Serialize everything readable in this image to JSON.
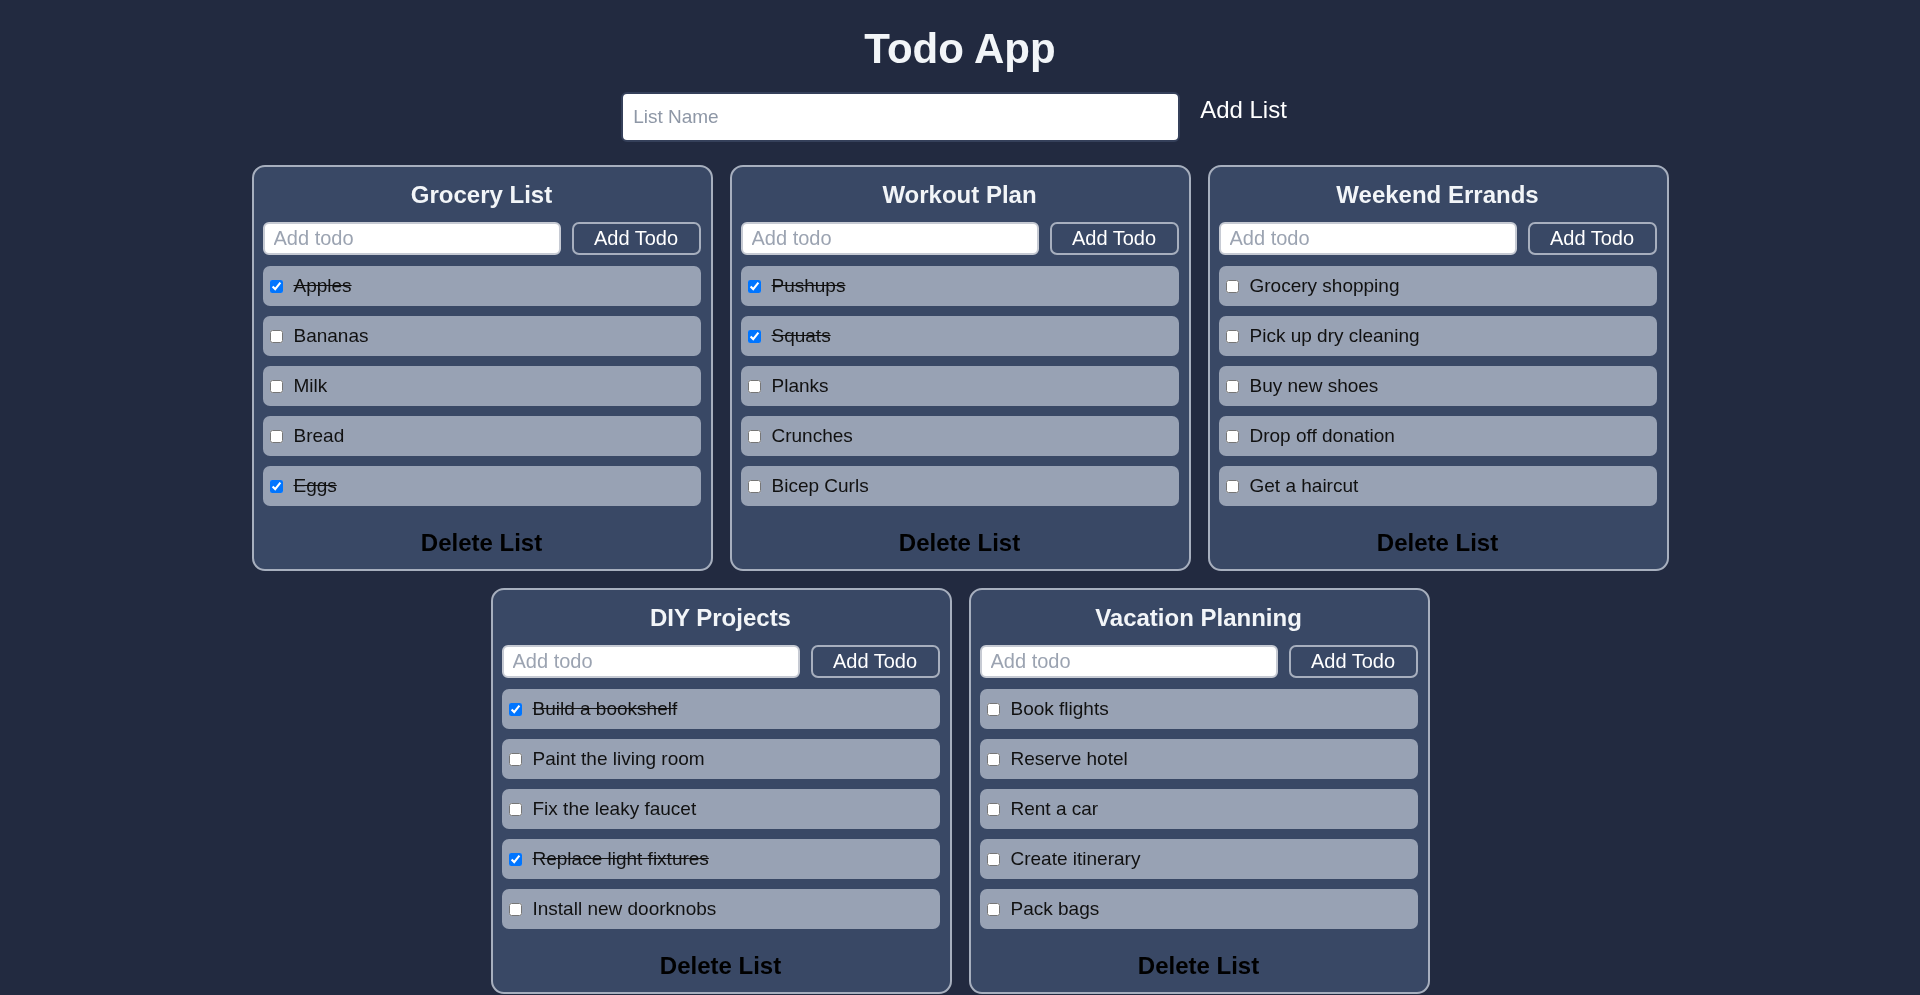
{
  "title": "Todo App",
  "new_list": {
    "placeholder": "List Name",
    "button": "Add List"
  },
  "lists": [
    {
      "name": "Grocery List",
      "todo_placeholder": "Add todo",
      "add_button": "Add Todo",
      "todos": [
        {
          "text": "Apples",
          "checked": true
        },
        {
          "text": "Bananas",
          "checked": false
        },
        {
          "text": "Milk",
          "checked": false
        },
        {
          "text": "Bread",
          "checked": false
        },
        {
          "text": "Eggs",
          "checked": true
        }
      ],
      "delete_button": "Delete List"
    },
    {
      "name": "Workout Plan",
      "todo_placeholder": "Add todo",
      "add_button": "Add Todo",
      "todos": [
        {
          "text": "Pushups",
          "checked": true
        },
        {
          "text": "Squats",
          "checked": true
        },
        {
          "text": "Planks",
          "checked": false
        },
        {
          "text": "Crunches",
          "checked": false
        },
        {
          "text": "Bicep Curls",
          "checked": false
        }
      ],
      "delete_button": "Delete List"
    },
    {
      "name": "Weekend Errands",
      "todo_placeholder": "Add todo",
      "add_button": "Add Todo",
      "todos": [
        {
          "text": "Grocery shopping",
          "checked": false
        },
        {
          "text": "Pick up dry cleaning",
          "checked": false
        },
        {
          "text": "Buy new shoes",
          "checked": false
        },
        {
          "text": "Drop off donation",
          "checked": false
        },
        {
          "text": "Get a haircut",
          "checked": false
        }
      ],
      "delete_button": "Delete List"
    },
    {
      "name": "DIY Projects",
      "todo_placeholder": "Add todo",
      "add_button": "Add Todo",
      "todos": [
        {
          "text": "Build a bookshelf",
          "checked": true
        },
        {
          "text": "Paint the living room",
          "checked": false
        },
        {
          "text": "Fix the leaky faucet",
          "checked": false
        },
        {
          "text": "Replace light fixtures",
          "checked": true
        },
        {
          "text": "Install new doorknobs",
          "checked": false
        }
      ],
      "delete_button": "Delete List"
    },
    {
      "name": "Vacation Planning",
      "todo_placeholder": "Add todo",
      "add_button": "Add Todo",
      "todos": [
        {
          "text": "Book flights",
          "checked": false
        },
        {
          "text": "Reserve hotel",
          "checked": false
        },
        {
          "text": "Rent a car",
          "checked": false
        },
        {
          "text": "Create itinerary",
          "checked": false
        },
        {
          "text": "Pack bags",
          "checked": false
        }
      ],
      "delete_button": "Delete List"
    }
  ]
}
